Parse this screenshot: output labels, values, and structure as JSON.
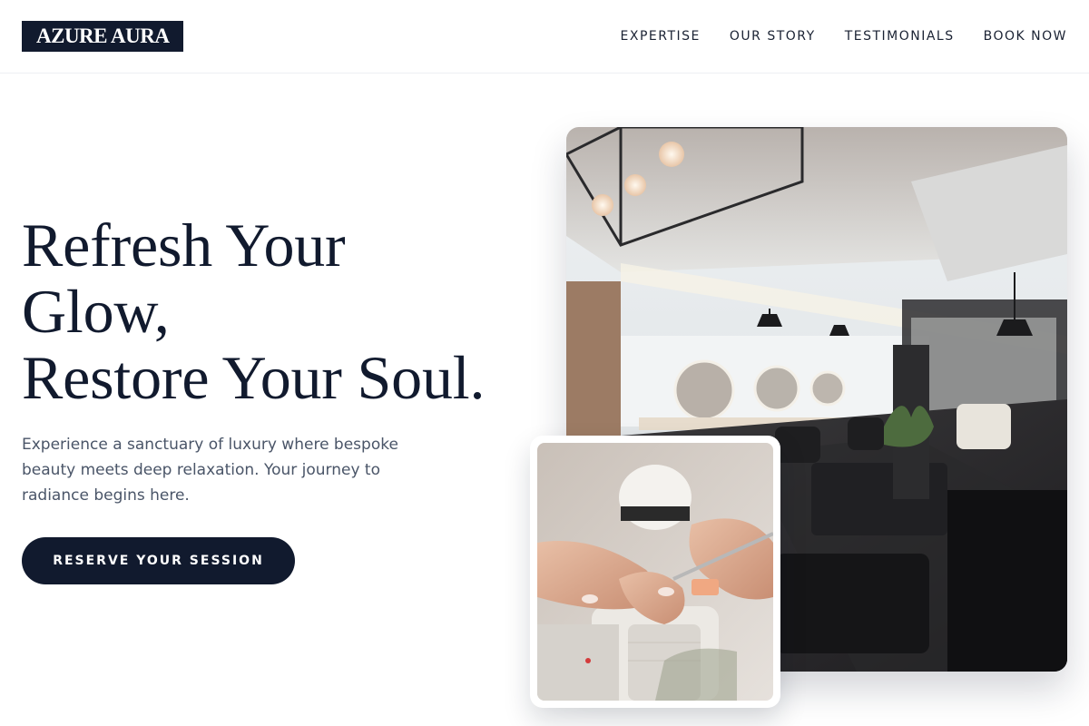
{
  "header": {
    "logo": "AZURE AURA",
    "nav": [
      "EXPERTISE",
      "OUR STORY",
      "TESTIMONIALS",
      "BOOK NOW"
    ]
  },
  "hero": {
    "headline_lines": [
      "Refresh Your",
      "Glow,",
      "Restore Your Soul."
    ],
    "description": "Experience a sanctuary of luxury where bespoke beauty meets deep relaxation. Your journey to radiance begins here.",
    "cta_label": "RESERVE YOUR SESSION"
  },
  "images": {
    "main": "salon-interior-photo",
    "secondary": "manicure-photo"
  },
  "colors": {
    "brand_dark": "#111a2e",
    "text_body": "#4a5568",
    "background": "#ffffff"
  }
}
